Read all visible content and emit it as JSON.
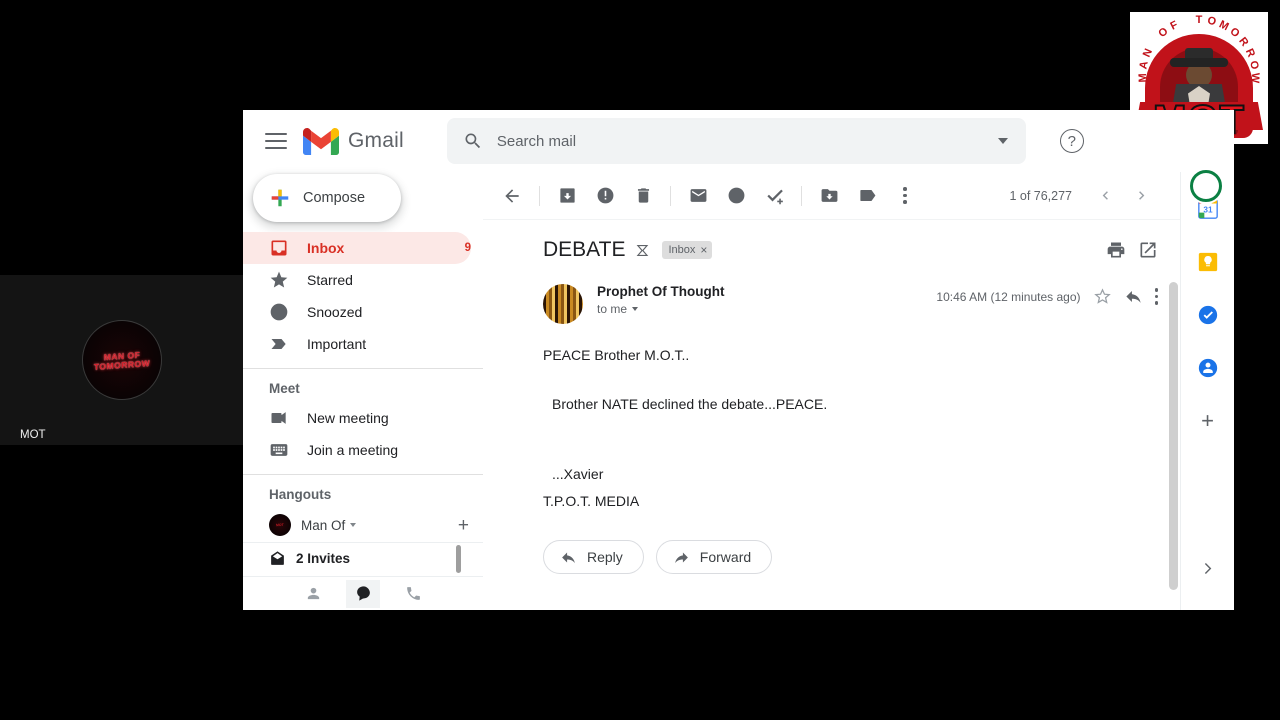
{
  "video": {
    "participant_label": "MOT",
    "avatar_text": "MAN OF TOMORROW"
  },
  "overlay_logo": {
    "arc_text": "MAN OF TOMORROW",
    "big_text": "MOT"
  },
  "topbar": {
    "menu_icon": "hamburger-icon",
    "logo_icon": "gmail-logo-icon",
    "brand": "Gmail",
    "search": {
      "icon": "search-icon",
      "value": "",
      "placeholder": "Search mail",
      "options_icon": "chevron-down-icon"
    },
    "help_label": "?",
    "help_icon": "help-icon"
  },
  "sidebar": {
    "compose_label": "Compose",
    "compose_icon": "plus-icon",
    "items": [
      {
        "label": "Inbox",
        "icon": "inbox-icon",
        "count": "9",
        "active": true
      },
      {
        "label": "Starred",
        "icon": "star-icon",
        "count": "",
        "active": false
      },
      {
        "label": "Snoozed",
        "icon": "clock-icon",
        "count": "",
        "active": false
      },
      {
        "label": "Important",
        "icon": "label-important-icon",
        "count": "",
        "active": false
      }
    ],
    "meet": {
      "heading": "Meet",
      "items": [
        {
          "label": "New meeting",
          "icon": "video-camera-icon"
        },
        {
          "label": "Join a meeting",
          "icon": "keyboard-icon"
        }
      ]
    },
    "hangouts": {
      "heading": "Hangouts",
      "user_name": "Man Of",
      "user_avatar_text": "MOT",
      "status_caret_icon": "chevron-down-icon",
      "new_chat_icon": "plus-icon",
      "invites_label": "2 Invites",
      "invites_icon": "envelope-open-icon",
      "tabs": [
        {
          "icon": "person-icon",
          "selected": false
        },
        {
          "icon": "chat-bubble-icon",
          "selected": true
        },
        {
          "icon": "phone-icon",
          "selected": false
        }
      ]
    }
  },
  "toolbar": {
    "back_icon": "arrow-back-icon",
    "archive_icon": "archive-icon",
    "spam_icon": "report-spam-icon",
    "delete_icon": "trash-icon",
    "unread_icon": "mark-unread-icon",
    "snooze_icon": "clock-icon",
    "tasks_icon": "add-to-tasks-icon",
    "move_icon": "move-to-folder-icon",
    "labels_icon": "label-icon",
    "more_icon": "more-vertical-icon",
    "pager_text": "1 of 76,277",
    "prev_icon": "chevron-left-icon",
    "next_icon": "chevron-right-icon"
  },
  "mail": {
    "subject": "DEBATE",
    "inbox_type_icon": "inbox-arrow-icon",
    "label_chip": "Inbox",
    "label_chip_remove": "×",
    "print_icon": "print-icon",
    "popout_icon": "open-in-new-icon",
    "sender": "Prophet Of Thought",
    "recipient": "to me",
    "recipient_caret_icon": "chevron-down-icon",
    "timestamp": "10:46 AM (12 minutes ago)",
    "star_icon": "star-outline-icon",
    "reply_icon": "reply-arrow-icon",
    "more_icon": "more-vertical-icon",
    "body_lines": [
      "PEACE Brother M.O.T..",
      "",
      "Brother NATE declined the debate...PEACE.",
      "",
      "",
      "...Xavier",
      "T.P.O.T. MEDIA"
    ],
    "body_p1": "PEACE Brother M.O.T..",
    "body_p2": "Brother NATE declined the debate...PEACE.",
    "body_p3": "...Xavier",
    "body_p4": "T.P.O.T. MEDIA",
    "reply_label": "Reply",
    "forward_label": "Forward",
    "reply_btn_icon": "reply-arrow-icon",
    "forward_btn_icon": "forward-arrow-icon"
  },
  "rail": {
    "items": [
      {
        "icon": "google-calendar-icon",
        "color": "#1a73e8"
      },
      {
        "icon": "google-keep-icon",
        "color": "#fbbc04"
      },
      {
        "icon": "google-tasks-icon",
        "color": "#1a73e8"
      },
      {
        "icon": "google-contacts-icon",
        "color": "#1a73e8"
      }
    ],
    "add_label": "+",
    "add_icon": "plus-icon",
    "expand_icon": "chevron-right-icon"
  }
}
